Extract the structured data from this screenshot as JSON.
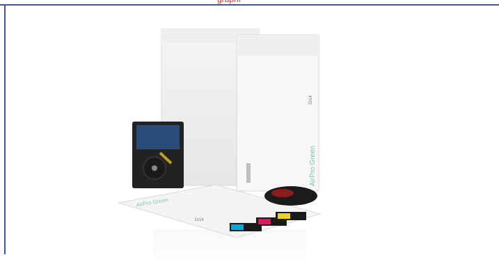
{
  "header": {
    "title_fragment": "graphi"
  },
  "photo": {
    "envelope_back_label": "",
    "envelope_front_size_label": "D/14",
    "envelope_front_brand": "AirPro Green",
    "envelope_flat_size_label": "D/14",
    "envelope_flat_brand": "AirPro Green"
  }
}
